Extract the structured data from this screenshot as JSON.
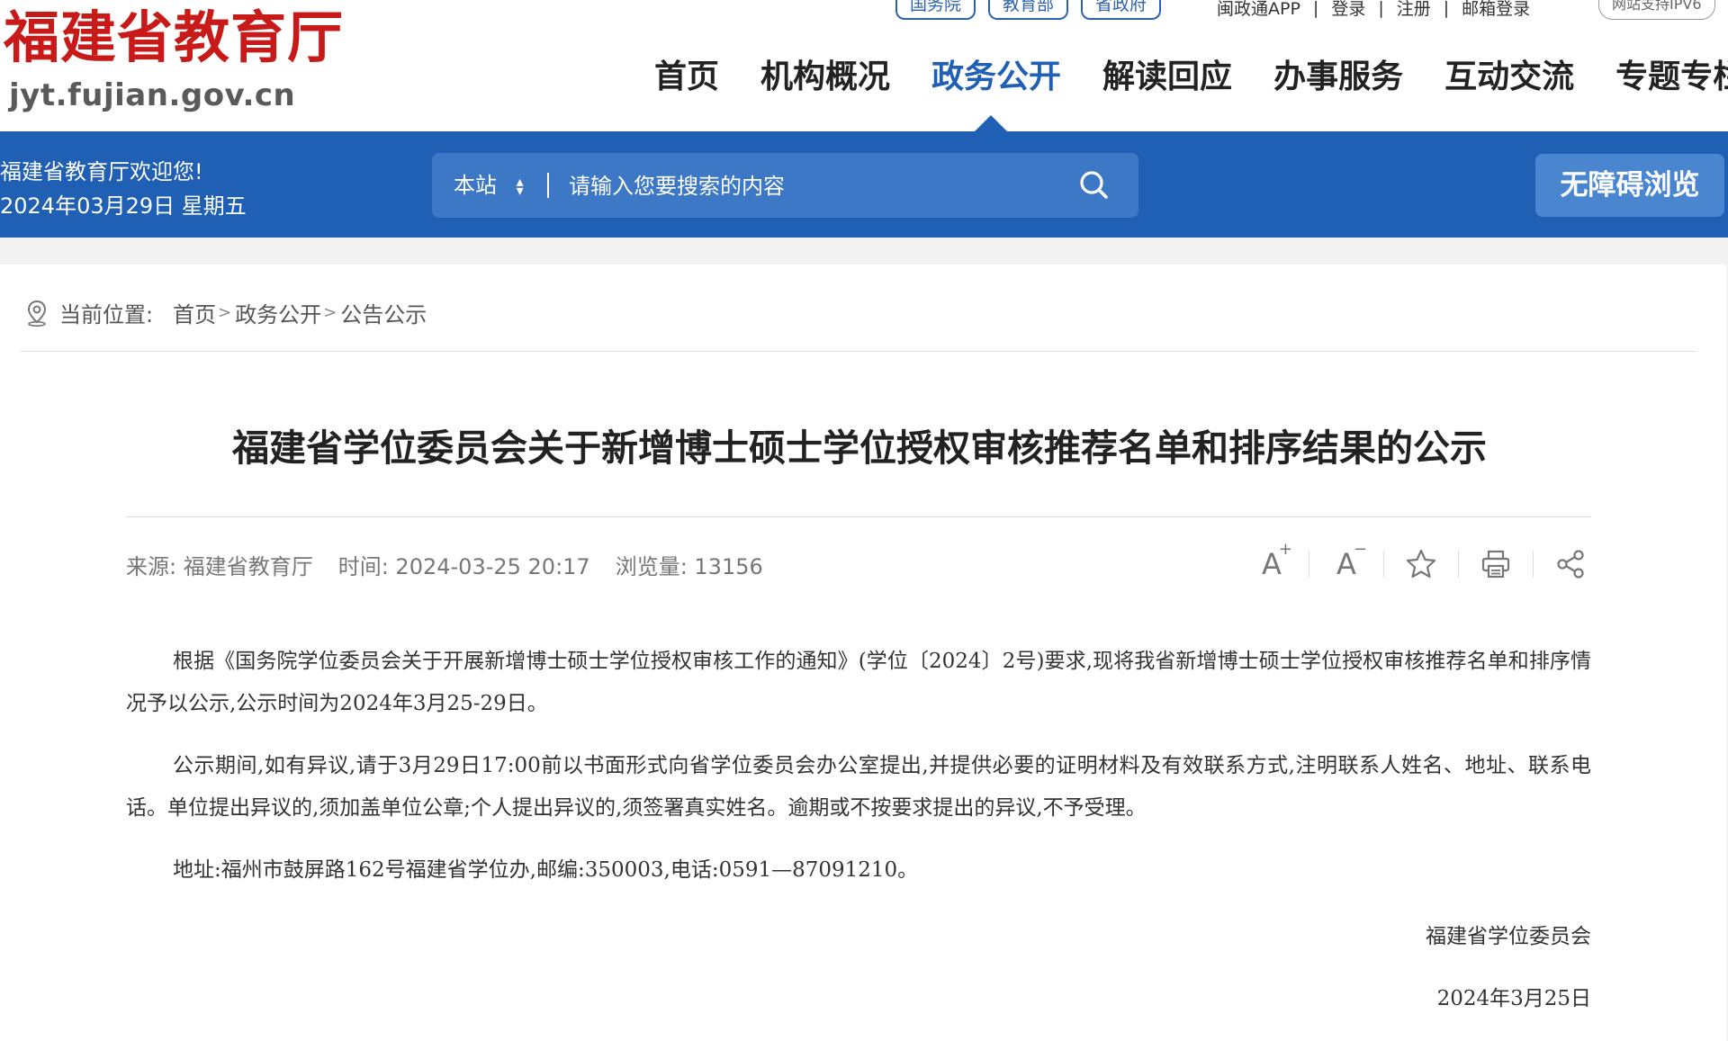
{
  "header": {
    "logo_title": "福建省教育厅",
    "logo_domain": "jyt.fujian.gov.cn",
    "gov_links": [
      "国务院",
      "教育部",
      "省政府"
    ],
    "top_links": [
      "闽政通APP",
      "登录",
      "注册",
      "邮箱登录"
    ],
    "ipv6_badge": "网站支持IPV6",
    "nav": [
      {
        "label": "首页",
        "active": false
      },
      {
        "label": "机构概况",
        "active": false
      },
      {
        "label": "政务公开",
        "active": true
      },
      {
        "label": "解读回应",
        "active": false
      },
      {
        "label": "办事服务",
        "active": false
      },
      {
        "label": "互动交流",
        "active": false
      },
      {
        "label": "专题专栏",
        "active": false
      }
    ]
  },
  "bluebar": {
    "welcome": "福建省教育厅欢迎您!",
    "date": "2024年03月29日 星期五",
    "search_scope": "本站",
    "search_placeholder": "请输入您要搜索的内容",
    "accessibility_button": "无障碍浏览"
  },
  "breadcrumb": {
    "label": "当前位置:",
    "items": [
      "首页",
      "政务公开",
      "公告公示"
    ]
  },
  "article": {
    "title": "福建省学位委员会关于新增博士硕士学位授权审核推荐名单和排序结果的公示",
    "meta": {
      "source": "来源: 福建省教育厅",
      "time": "时间: 2024-03-25 20:17",
      "views": "浏览量: 13156"
    },
    "paragraphs": [
      "根据《国务院学位委员会关于开展新增博士硕士学位授权审核工作的通知》(学位〔2024〕2号)要求,现将我省新增博士硕士学位授权审核推荐名单和排序情况予以公示,公示时间为2024年3月25-29日。",
      "公示期间,如有异议,请于3月29日17:00前以书面形式向省学位委员会办公室提出,并提供必要的证明材料及有效联系方式,注明联系人姓名、地址、联系电话。单位提出异议的,须加盖单位公章;个人提出异议的,须签署真实姓名。逾期或不按要求提出的异议,不予受理。",
      "地址:福州市鼓屏路162号福建省学位办,邮编:350003,电话:0591—87091210。"
    ],
    "signature": "福建省学位委员会",
    "signature_date": "2024年3月25日"
  },
  "colors": {
    "brand_red": "#c91a1a",
    "primary_blue": "#1f5fb4",
    "search_blue": "#3d78c6",
    "button_blue": "#4a85d0"
  },
  "icons": [
    "location-pin-icon",
    "sort-arrows-icon",
    "search-icon",
    "font-increase-icon",
    "font-decrease-icon",
    "star-icon",
    "print-icon",
    "share-icon"
  ]
}
